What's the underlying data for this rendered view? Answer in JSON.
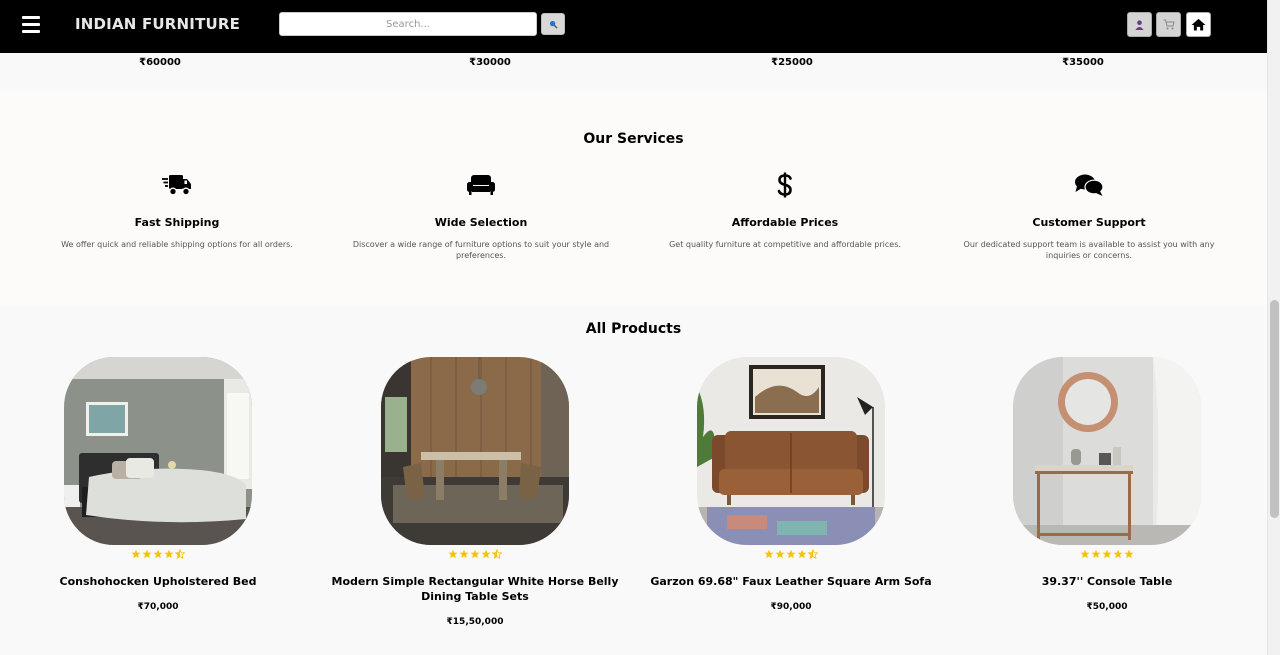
{
  "navbar": {
    "brand": "INDIAN FURNITURE",
    "search_placeholder": "Search...",
    "icons": [
      "menu-icon",
      "search-icon",
      "user-icon",
      "cart-icon",
      "home-icon"
    ]
  },
  "top_prices": [
    "₹60000",
    "₹30000",
    "₹25000",
    "₹35000"
  ],
  "services": {
    "title": "Our Services",
    "items": [
      {
        "icon": "shipping-truck-icon",
        "title": "Fast Shipping",
        "desc": "We offer quick and reliable shipping options for all orders."
      },
      {
        "icon": "couch-icon",
        "title": "Wide Selection",
        "desc": "Discover a wide range of furniture options to suit your style and preferences."
      },
      {
        "icon": "dollar-icon",
        "title": "Affordable Prices",
        "desc": "Get quality furniture at competitive and affordable prices."
      },
      {
        "icon": "chat-bubbles-icon",
        "title": "Customer Support",
        "desc": "Our dedicated support team is available to assist you with any inquiries or concerns."
      }
    ]
  },
  "products": {
    "title": "All Products",
    "items": [
      {
        "name": "Conshohocken Upholstered Bed",
        "price": "₹70,000",
        "rating": 4.5
      },
      {
        "name": "Modern Simple Rectangular White Horse Belly Dining Table Sets",
        "price": "₹15,50,000",
        "rating": 4.5
      },
      {
        "name": "Garzon 69.68\" Faux Leather Square Arm Sofa",
        "price": "₹90,000",
        "rating": 4.5
      },
      {
        "name": "39.37'' Console Table",
        "price": "₹50,000",
        "rating": 5
      }
    ]
  },
  "colors": {
    "navbar": "#000000",
    "star": "#f2c40f",
    "background": "#f9f9f9"
  }
}
